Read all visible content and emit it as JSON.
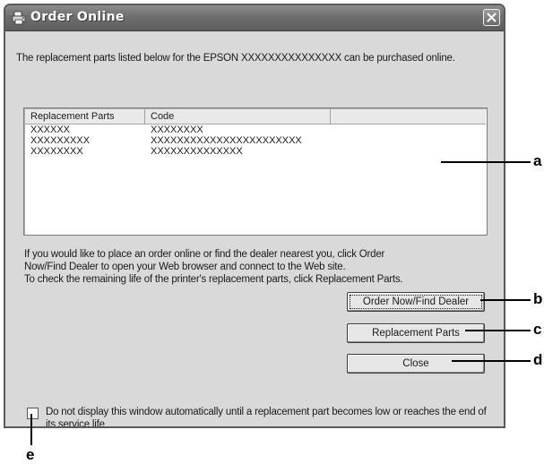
{
  "window": {
    "title": "Order Online",
    "icons": {
      "title": "printer-icon",
      "close": "close-icon",
      "checkbox": "checkbox-icon"
    }
  },
  "intro_text": "The replacement parts listed below for the EPSON XXXXXXXXXXXXXXX can be purchased online.",
  "parts_list": {
    "columns": [
      "Replacement Parts",
      "Code",
      ""
    ],
    "rows": [
      [
        "XXXXXX",
        "XXXXXXXX"
      ],
      [
        "XXXXXXXXX",
        "XXXXXXXXXXXXXXXXXXXXXXX"
      ],
      [
        "XXXXXXXX",
        "XXXXXXXXXXXXXX"
      ]
    ]
  },
  "info_text": {
    "line1": "If you would like to place an order online or find the dealer nearest you, click Order",
    "line2": "Now/Find Dealer to open your Web browser and connect to the Web site.",
    "line3": "To check the remaining life of the printer's replacement parts, click Replacement Parts."
  },
  "buttons": {
    "order_now": "Order Now/Find Dealer",
    "replacement_parts": "Replacement Parts",
    "close": "Close"
  },
  "checkbox": {
    "checked": false,
    "label": "Do not display this window automatically until a replacement part becomes low or reaches the end of its service life"
  },
  "callouts": {
    "a": "a",
    "b": "b",
    "c": "c",
    "d": "d",
    "e": "e"
  }
}
